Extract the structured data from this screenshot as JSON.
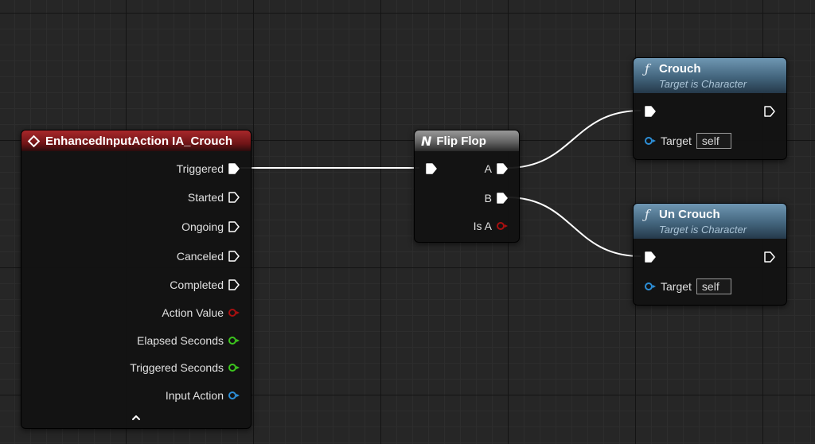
{
  "event_node": {
    "title": "EnhancedInputAction IA_Crouch",
    "outputs": {
      "triggered": "Triggered",
      "started": "Started",
      "ongoing": "Ongoing",
      "canceled": "Canceled",
      "completed": "Completed",
      "action_value": "Action Value",
      "elapsed_seconds": "Elapsed Seconds",
      "triggered_seconds": "Triggered Seconds",
      "input_action": "Input Action"
    },
    "collapse_icon": "chevron-up-icon"
  },
  "flipflop_node": {
    "title": "Flip Flop",
    "outputs": {
      "a": "A",
      "b": "B",
      "is_a": "Is A"
    }
  },
  "crouch_node": {
    "title": "Crouch",
    "subtitle": "Target is Character",
    "target_label": "Target",
    "target_value": "self"
  },
  "uncrouch_node": {
    "title": "Un Crouch",
    "subtitle": "Target is Character",
    "target_label": "Target",
    "target_value": "self"
  },
  "colors": {
    "event_header": "#a8272a",
    "function_header": "#5a80a0",
    "flipflop_header": "#808080",
    "pin_float": "#a81010",
    "pin_time": "#3cc41e",
    "pin_object": "#2d8ed6",
    "exec_wire": "#ffffff"
  }
}
